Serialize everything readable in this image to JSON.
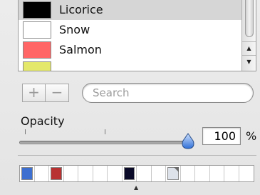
{
  "color_list": {
    "items": [
      {
        "name": "Licorice",
        "color": "#000000",
        "selected": true
      },
      {
        "name": "Snow",
        "color": "#ffffff",
        "selected": false
      },
      {
        "name": "Salmon",
        "color": "#ff6666",
        "selected": false
      }
    ],
    "partial_next_color": "#e4e86a"
  },
  "toolbar": {
    "add_label": "+",
    "remove_label": "−",
    "search_placeholder": "Search"
  },
  "opacity": {
    "label": "Opacity",
    "value": "100",
    "unit": "%",
    "fraction": 1.0
  },
  "swatches": {
    "wells": [
      {
        "color": "#3d6fd0"
      },
      {
        "color": "#ffffff"
      },
      {
        "color": "#b83232"
      },
      {
        "color": "#ffffff"
      },
      {
        "color": "#ffffff"
      },
      {
        "color": "#ffffff"
      },
      {
        "color": "#ffffff"
      },
      {
        "color": "#0a0a28"
      },
      {
        "color": "#ffffff"
      },
      {
        "color": "#ffffff"
      },
      {
        "color": "#dde2ea",
        "corner": true
      },
      {
        "color": "#ffffff"
      },
      {
        "color": "#ffffff"
      },
      {
        "color": "#ffffff"
      },
      {
        "color": "#ffffff"
      },
      {
        "color": "#ffffff"
      }
    ]
  },
  "icons": {
    "scroll_up": "▲",
    "scroll_down": "▼",
    "grip": "▲"
  }
}
